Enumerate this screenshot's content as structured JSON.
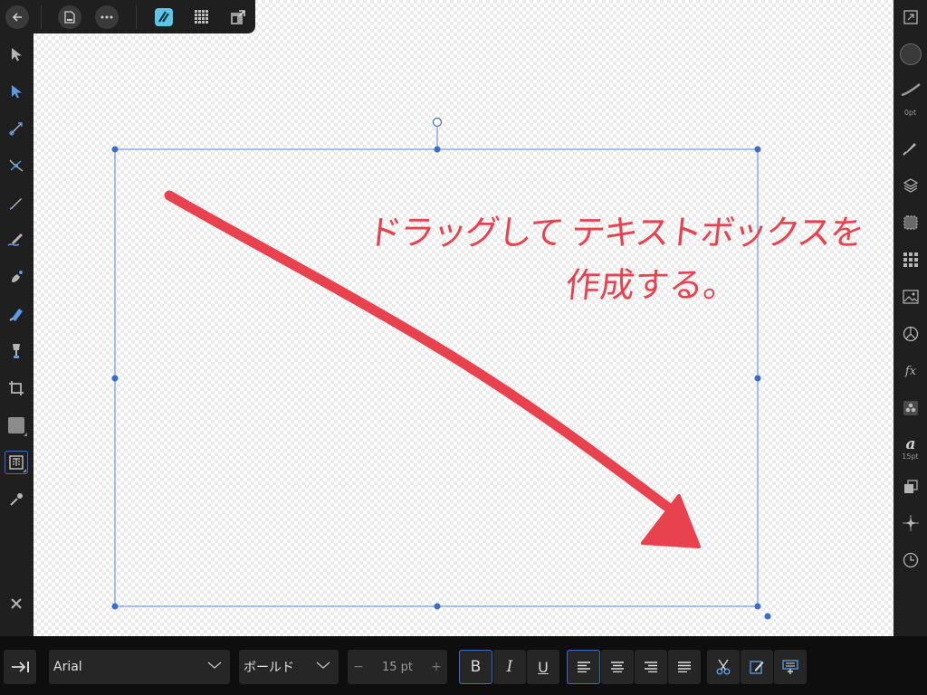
{
  "app": {
    "accent_color": "#3b6cc7",
    "annotation_color": "#e8424f"
  },
  "top_toolbar": {
    "icons": [
      "back-arrow-icon",
      "document-icon",
      "more-icon",
      "designer-persona-icon",
      "pixel-persona-icon",
      "export-persona-icon"
    ]
  },
  "left_tools": [
    "move-tool-icon",
    "node-tool-icon",
    "corner-tool-icon",
    "point-transform-tool-icon",
    "pen-tool-icon",
    "pencil-tool-icon",
    "vector-brush-tool-icon",
    "fill-tool-icon",
    "transparency-tool-icon",
    "crop-tool-icon",
    "shape-tool-icon",
    "text-tool-icon",
    "color-picker-tool-icon",
    "close-icon"
  ],
  "right_panel": {
    "fill_color": "#3a3a3a",
    "stroke_size_label": "0pt",
    "text_size_label": "15pt",
    "icons": [
      "fullscreen-icon",
      "color-swatch-icon",
      "stroke-icon",
      "brushes-icon",
      "layers-icon",
      "selection-icon",
      "swatches-grid-icon",
      "image-stock-icon",
      "transform-icon",
      "fx-icon",
      "assets-icon",
      "text-style-icon",
      "arrange-icon",
      "snapping-icon",
      "history-icon"
    ]
  },
  "annotation": {
    "line1": "ドラッグして テキストボックスを",
    "line2": "作成する。"
  },
  "bottom_toolbar": {
    "tab_icon": "tab-insert-icon",
    "font_family": "Arial",
    "font_weight": "ボールド",
    "font_size": "15 pt",
    "minus": "−",
    "plus": "+",
    "bold": "B",
    "italic": "I",
    "underline": "U",
    "align": [
      "align-left-icon",
      "align-center-icon",
      "align-right-icon",
      "justify-icon"
    ],
    "actions": [
      "cut-icon",
      "edit-text-icon",
      "insert-text-icon"
    ]
  }
}
